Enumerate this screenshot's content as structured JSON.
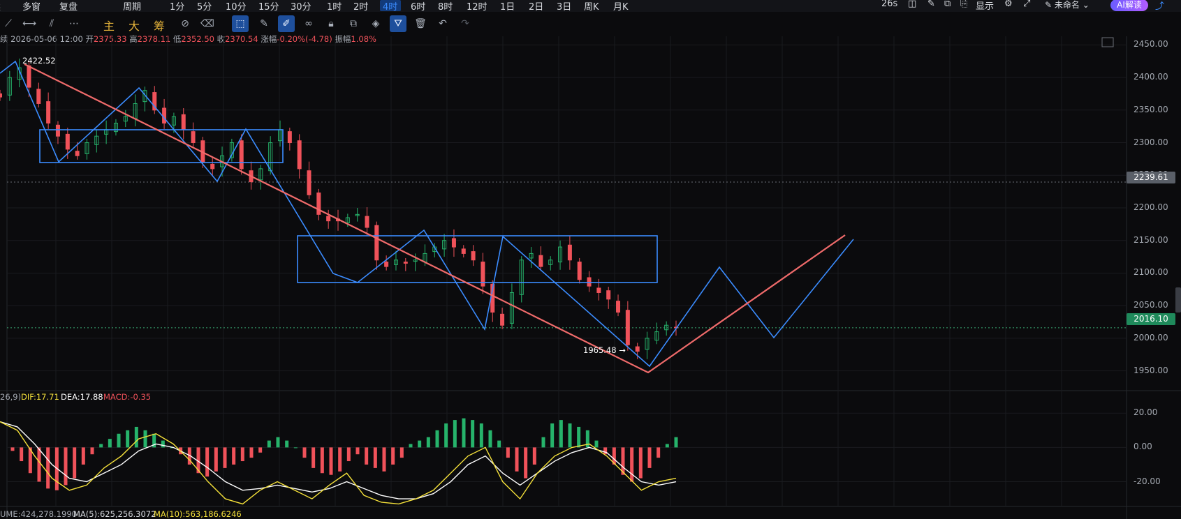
{
  "topbar": {
    "left_items": [
      "续",
      "多窗",
      "复盘",
      "周期",
      "1分",
      "5分",
      "10分",
      "15分",
      "30分",
      "1时",
      "2时",
      "4时",
      "6时",
      "8时",
      "12时",
      "1日",
      "2日",
      "3日",
      "周K",
      "月K"
    ],
    "active_period": "4时",
    "countdown": "26s",
    "display_label": "显示",
    "template_label": "未命名",
    "ai_label": "AI解读"
  },
  "toolbar": {
    "indicator_labels": [
      "主",
      "大",
      "筹"
    ]
  },
  "ohlc": {
    "prefix": "续",
    "datetime": "2026-05-06 12:00",
    "open_label": "开",
    "open": "2375.33",
    "high_label": "高",
    "high": "2378.11",
    "low_label": "低",
    "low": "2352.50",
    "close_label": "收",
    "close": "2370.54",
    "change_label": "涨幅",
    "change": "-0.20%(-4.78)",
    "amplitude_label": "振幅",
    "amplitude": "1.08%"
  },
  "price_axis": {
    "ticks": [
      "2450.00",
      "2400.00",
      "2350.00",
      "2300.00",
      "2250.00",
      "2200.00",
      "2150.00",
      "2100.00",
      "2050.00",
      "2000.00",
      "1950.00"
    ],
    "crosshair_price": "2239.61",
    "last_price": "2016.10"
  },
  "annotations": {
    "high_marker": "2422.52",
    "low_marker": "1965.48"
  },
  "macd": {
    "params": "26,9)",
    "dif": "DIF:17.71",
    "dea": "DEA:17.88",
    "macd": "MACD:-0.35",
    "axis_ticks": [
      "20.00",
      "0.00",
      "-20.00"
    ]
  },
  "volume": {
    "vol": "UME:424,278.1990",
    "ma5": "MA(5):625,256.3072",
    "ma10": "MA(10):563,186.6246"
  },
  "colors": {
    "up": "#26b36b",
    "down": "#f0525a",
    "trend_line": "#f06b6b",
    "pattern_line": "#3b8cff",
    "dif": "#f5e13a",
    "dea": "#ffffff",
    "crosshair_tag": "#5a5f68",
    "last_tag": "#1f8a5b"
  },
  "chart_data": {
    "type": "candlestick",
    "interval": "4时",
    "price_range": [
      1925,
      2460
    ],
    "series_close_path": [
      2370,
      2400,
      2415,
      2385,
      2360,
      2330,
      2310,
      2290,
      2280,
      2300,
      2310,
      2320,
      2330,
      2340,
      2360,
      2380,
      2350,
      2330,
      2340,
      2320,
      2300,
      2270,
      2260,
      2280,
      2300,
      2260,
      2240,
      2260,
      2300,
      2320,
      2300,
      2260,
      2220,
      2190,
      2180,
      2180,
      2185,
      2190,
      2170,
      2120,
      2110,
      2120,
      2115,
      2120,
      2130,
      2140,
      2150,
      2140,
      2130,
      2120,
      2080,
      2040,
      2020,
      2070,
      2120,
      2130,
      2110,
      2120,
      2140,
      2120,
      2090,
      2080,
      2070,
      2060,
      2040,
      1990,
      1980,
      2000,
      2010,
      2020,
      2016
    ],
    "macd_histogram": [
      -2,
      -8,
      -15,
      -20,
      -24,
      -25,
      -22,
      -18,
      -10,
      -4,
      2,
      5,
      8,
      10,
      12,
      10,
      8,
      4,
      0,
      -4,
      -10,
      -15,
      -17,
      -14,
      -12,
      -10,
      -8,
      -6,
      -3,
      4,
      6,
      4,
      0,
      -6,
      -12,
      -15,
      -16,
      -14,
      -8,
      -4,
      -10,
      -12,
      -14,
      -10,
      -6,
      2,
      4,
      6,
      10,
      14,
      16,
      17,
      16,
      14,
      10,
      4,
      -6,
      -14,
      -18,
      -10,
      6,
      14,
      16,
      14,
      12,
      10,
      4,
      -4,
      -10,
      -16,
      -20,
      -18,
      -12,
      -6,
      2,
      6
    ]
  }
}
